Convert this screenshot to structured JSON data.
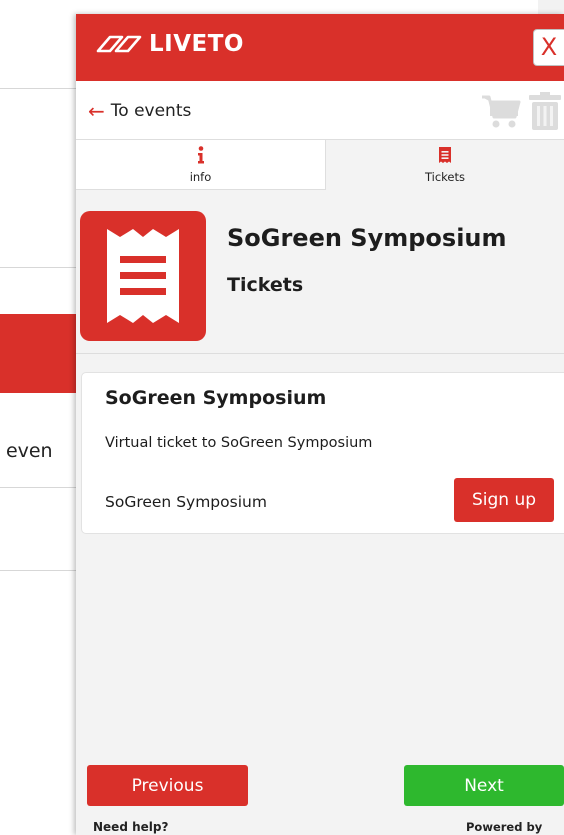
{
  "brand": {
    "name": "LIVETO",
    "accent": "#d9302a",
    "success": "#2eb82e"
  },
  "header": {
    "close_label": "X"
  },
  "nav": {
    "back_label": "To events",
    "cart_icon": "cart-icon",
    "trash_icon": "trash-icon"
  },
  "tabs": [
    {
      "label": "info",
      "icon": "info-icon",
      "active": false
    },
    {
      "label": "Tickets",
      "icon": "ticket-icon",
      "active": true
    }
  ],
  "event": {
    "title": "SoGreen Symposium",
    "subtitle": "Tickets",
    "logo_icon": "ticket-receipt-icon"
  },
  "ticket": {
    "title": "SoGreen Symposium",
    "description": "Virtual ticket to SoGreen Symposium",
    "name": "SoGreen Symposium",
    "signup_label": "Sign up"
  },
  "footer": {
    "previous_label": "Previous",
    "next_label": "Next",
    "help_label": "Need help?",
    "powered_label": "Powered by"
  },
  "background": {
    "partial_text": "s even"
  }
}
